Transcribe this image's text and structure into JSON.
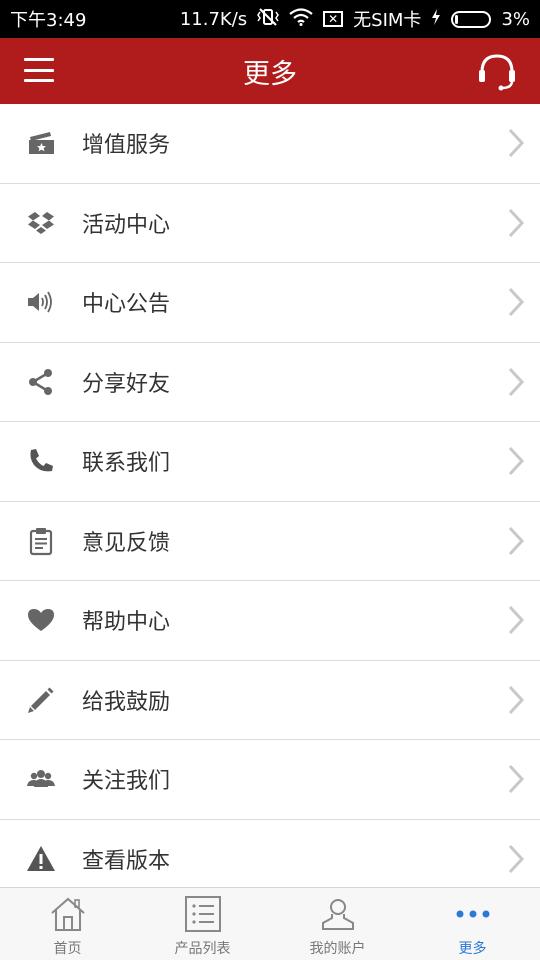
{
  "status_bar": {
    "time": "下午3:49",
    "speed": "11.7K/s",
    "sim": "无SIM卡",
    "battery": "3%",
    "battery_level": 3
  },
  "header": {
    "title": "更多"
  },
  "menu": {
    "items": [
      {
        "label": "增值服务",
        "icon": "ticket-star-icon"
      },
      {
        "label": "活动中心",
        "icon": "dropbox-icon"
      },
      {
        "label": "中心公告",
        "icon": "speaker-icon"
      },
      {
        "label": "分享好友",
        "icon": "share-icon"
      },
      {
        "label": "联系我们",
        "icon": "phone-icon"
      },
      {
        "label": "意见反馈",
        "icon": "clipboard-icon"
      },
      {
        "label": "帮助中心",
        "icon": "heart-icon"
      },
      {
        "label": "给我鼓励",
        "icon": "pencil-icon"
      },
      {
        "label": "关注我们",
        "icon": "group-icon"
      },
      {
        "label": "查看版本",
        "icon": "warning-icon"
      }
    ]
  },
  "tabbar": {
    "tabs": [
      {
        "label": "首页",
        "icon": "home-icon"
      },
      {
        "label": "产品列表",
        "icon": "list-icon"
      },
      {
        "label": "我的账户",
        "icon": "user-icon"
      },
      {
        "label": "更多",
        "icon": "more-icon"
      }
    ],
    "active_index": 3
  },
  "colors": {
    "header": "#b01c1c",
    "icon_gray": "#666666",
    "active_tab": "#2a79d6"
  }
}
